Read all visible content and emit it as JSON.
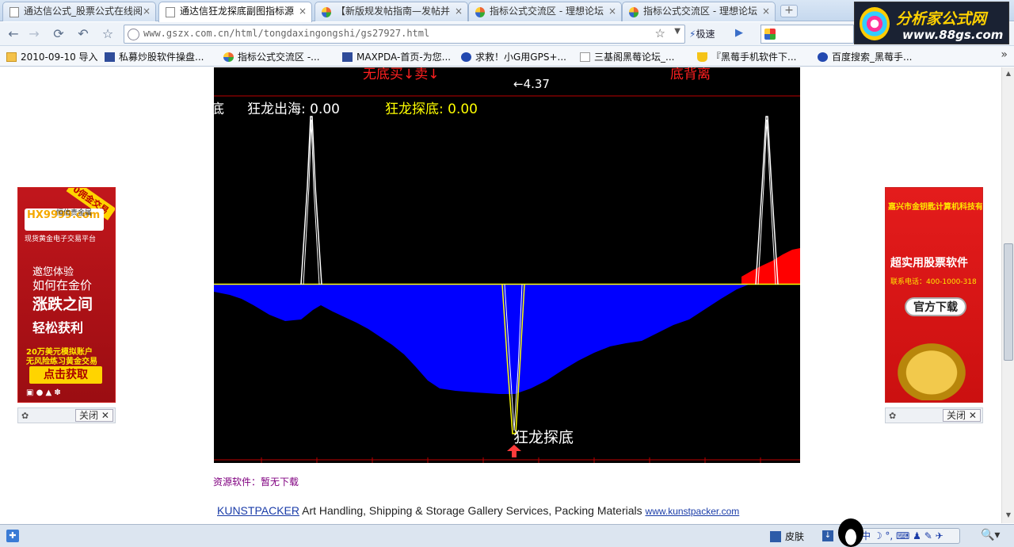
{
  "tabs": [
    {
      "label": "通达信公式_股票公式在线阅",
      "icon": "page-icon",
      "active": false
    },
    {
      "label": "通达信狂龙探底副图指标源",
      "icon": "page-icon",
      "active": true
    },
    {
      "label": "【新版规发帖指南—发帖并",
      "icon": "site-icon",
      "active": false
    },
    {
      "label": "指标公式交流区 - 理想论坛",
      "icon": "site-icon",
      "active": false
    },
    {
      "label": "指标公式交流区 - 理想论坛",
      "icon": "site-icon",
      "active": false
    }
  ],
  "logo": {
    "title": "分析家公式网",
    "url": "www.88gs.com"
  },
  "nav": {
    "address": "www.gszx.com.cn/html/tongdaxingongshi/gs27927.html",
    "speed_label": "极速"
  },
  "bookmarks": [
    {
      "label": "2010-09-10 导入",
      "icon": "folder-icon"
    },
    {
      "label": "私募炒股软件操盘...",
      "icon": "book-icon"
    },
    {
      "label": "指标公式交流区 -...",
      "icon": "site-icon"
    },
    {
      "label": "MAXPDA-首页-为您...",
      "icon": "maxpda-icon"
    },
    {
      "label": "求救！小G用GPS+...",
      "icon": "snow-icon"
    },
    {
      "label": "三基阁黑莓论坛_...",
      "icon": "page-icon"
    },
    {
      "label": "『黑莓手机软件下...",
      "icon": "cup-icon"
    },
    {
      "label": "百度搜索_黑莓手...",
      "icon": "paw-icon"
    }
  ],
  "chart": {
    "top_value": "4.37",
    "top_red_left": "无底买↓卖↓",
    "top_red_right": "底背离",
    "legend_cut": "底",
    "legend1_label": "狂龙出海: 0.00",
    "legend2_label": "狂龙探底: 0.00",
    "bottom_label": "狂龙探底",
    "colors": {
      "background": "#000000",
      "zero_line": "#ffff00",
      "area": "#0000ff",
      "up_area": "#ff0000",
      "legend1": "#ffffff",
      "legend2": "#ffff00"
    }
  },
  "resource_line": "资源软件：暂无下载",
  "sponsor": {
    "link_text": "KUNSTPACKER",
    "description": " Art Handling, Shipping & Storage Gallery Services, Packing Materials ",
    "url_text": "www.kunstpacker.com"
  },
  "ad_left": {
    "badge": "0佣金交易",
    "brand": "恒信贵金属",
    "brand_url": "HX9999.com",
    "tagline": "现货黄金电子交易平台",
    "line1": "邀您体验",
    "line2": "如何在金价",
    "line3": "涨跌之间",
    "line4": "轻松获利",
    "promo1": "20万美元模拟账户",
    "promo2": "无风险练习黄金交易",
    "cta": "点击获取",
    "close": "关闭"
  },
  "ad_right": {
    "company": "嘉兴市金钥匙计算机科技有限公司",
    "headline": "超实用股票软件",
    "phone": "联系电话：400-1000-318",
    "cta": "官方下载",
    "close": "关闭"
  },
  "status": {
    "skin_label": "皮肤",
    "ime_label": "中"
  }
}
